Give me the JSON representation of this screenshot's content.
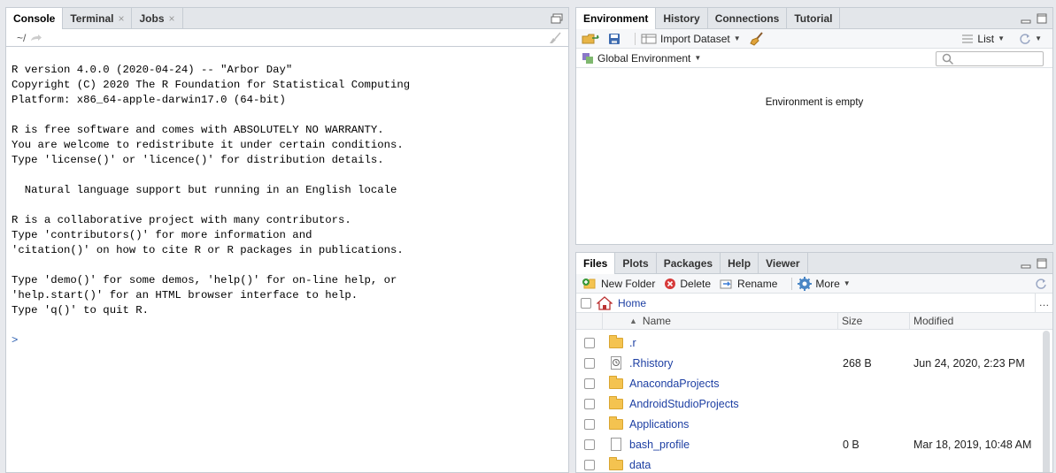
{
  "console": {
    "tabs": [
      {
        "label": "Console"
      },
      {
        "label": "Terminal",
        "close": "×"
      },
      {
        "label": "Jobs",
        "close": "×"
      }
    ],
    "path": "~/",
    "lines": [
      "R version 4.0.0 (2020-04-24) -- \"Arbor Day\"",
      "Copyright (C) 2020 The R Foundation for Statistical Computing",
      "Platform: x86_64-apple-darwin17.0 (64-bit)",
      "",
      "R is free software and comes with ABSOLUTELY NO WARRANTY.",
      "You are welcome to redistribute it under certain conditions.",
      "Type 'license()' or 'licence()' for distribution details.",
      "",
      "  Natural language support but running in an English locale",
      "",
      "R is a collaborative project with many contributors.",
      "Type 'contributors()' for more information and",
      "'citation()' on how to cite R or R packages in publications.",
      "",
      "Type 'demo()' for some demos, 'help()' for on-line help, or",
      "'help.start()' for an HTML browser interface to help.",
      "Type 'q()' to quit R."
    ],
    "prompt": ">"
  },
  "environment": {
    "tabs": [
      "Environment",
      "History",
      "Connections",
      "Tutorial"
    ],
    "import_label": "Import Dataset",
    "list_label": "List",
    "scope_label": "Global Environment",
    "empty_text": "Environment is empty"
  },
  "files": {
    "tabs": [
      "Files",
      "Plots",
      "Packages",
      "Help",
      "Viewer"
    ],
    "new_folder": "New Folder",
    "delete": "Delete",
    "rename": "Rename",
    "more": "More",
    "breadcrumb": "Home",
    "more_dots": "…",
    "columns": {
      "name": "Name",
      "size": "Size",
      "modified": "Modified"
    },
    "rows": [
      {
        "name": ".r",
        "type": "folder",
        "size": "",
        "modified": ""
      },
      {
        "name": ".Rhistory",
        "type": "history",
        "size": "268 B",
        "modified": "Jun 24, 2020, 2:23 PM"
      },
      {
        "name": "AnacondaProjects",
        "type": "folder",
        "size": "",
        "modified": ""
      },
      {
        "name": "AndroidStudioProjects",
        "type": "folder",
        "size": "",
        "modified": ""
      },
      {
        "name": "Applications",
        "type": "folder",
        "size": "",
        "modified": ""
      },
      {
        "name": "bash_profile",
        "type": "doc",
        "size": "0 B",
        "modified": "Mar 18, 2019, 10:48 AM"
      },
      {
        "name": "data",
        "type": "folder",
        "size": "",
        "modified": ""
      }
    ]
  },
  "colors": {
    "link": "#1d3fa3",
    "prompt": "#2a5db0",
    "folder": "#f4c350"
  }
}
